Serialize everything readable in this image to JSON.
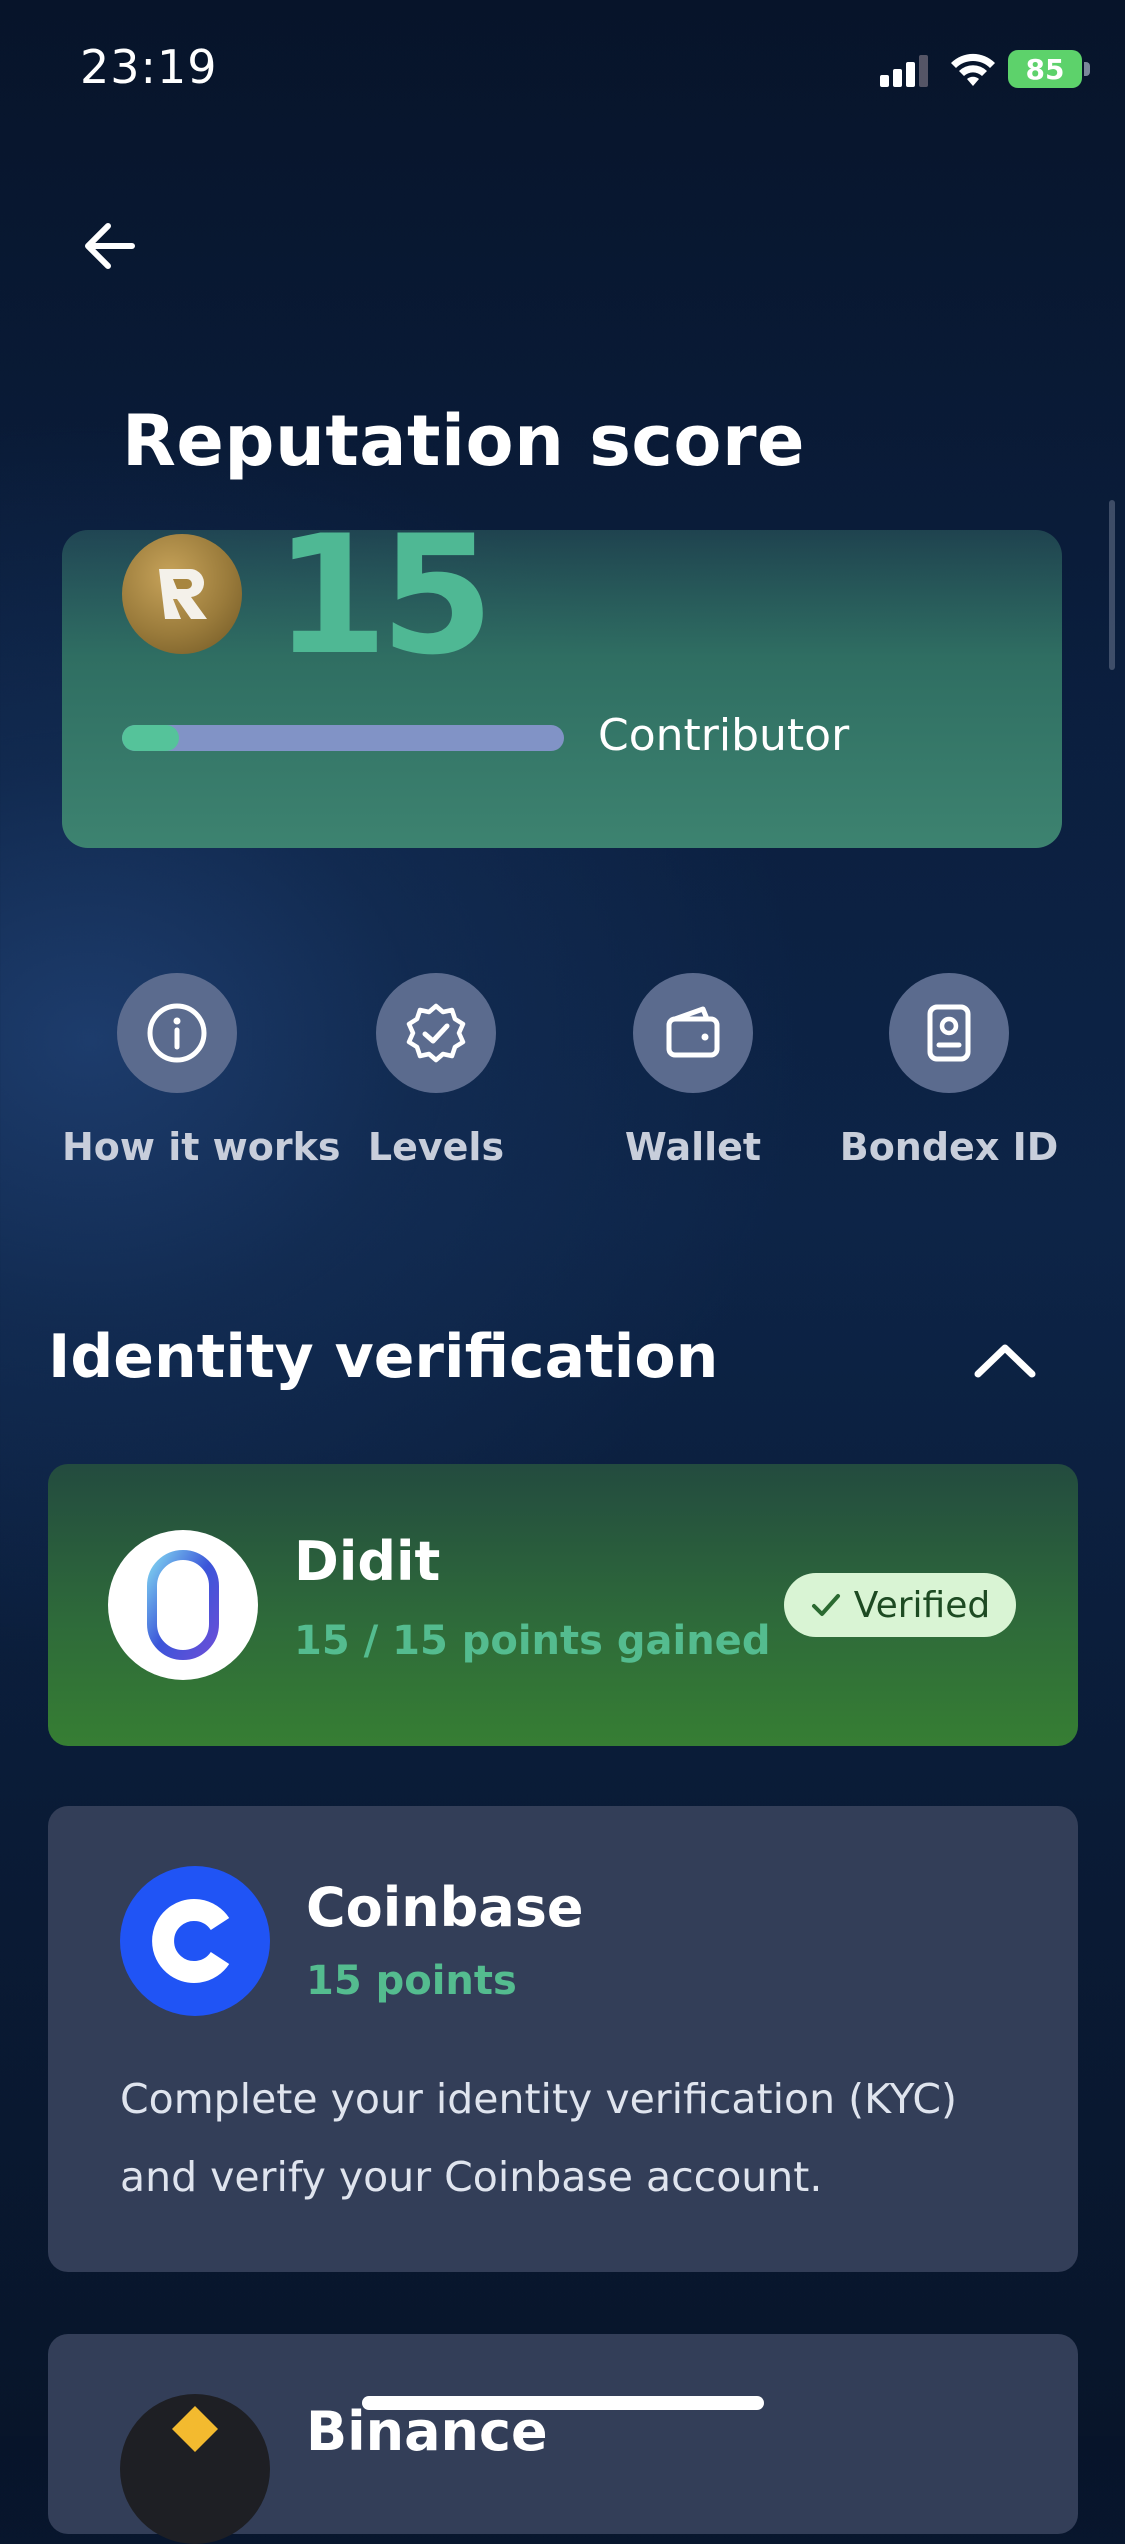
{
  "status_bar": {
    "time": "23:19",
    "battery": "85"
  },
  "header": {
    "title": "Reputation score"
  },
  "score": {
    "value": "15",
    "level": "Contributor",
    "progress": 0.13
  },
  "actions": [
    {
      "label": "How it works",
      "icon": "info-icon"
    },
    {
      "label": "Levels",
      "icon": "badge-check-icon"
    },
    {
      "label": "Wallet",
      "icon": "wallet-icon"
    },
    {
      "label": "Bondex ID",
      "icon": "id-card-icon"
    }
  ],
  "identity": {
    "title": "Identity verification",
    "didit": {
      "name": "Didit",
      "points": "15 / 15 points gained",
      "status": "Verified"
    },
    "coinbase": {
      "name": "Coinbase",
      "points": "15 points",
      "description": "Complete your identity verification (KYC) and verify your Coinbase account."
    },
    "binance": {
      "name": "Binance"
    }
  },
  "colors": {
    "accent": "#4fb894",
    "verified_bg": "#d9f4d4",
    "coinbase_blue": "#2054f5"
  }
}
